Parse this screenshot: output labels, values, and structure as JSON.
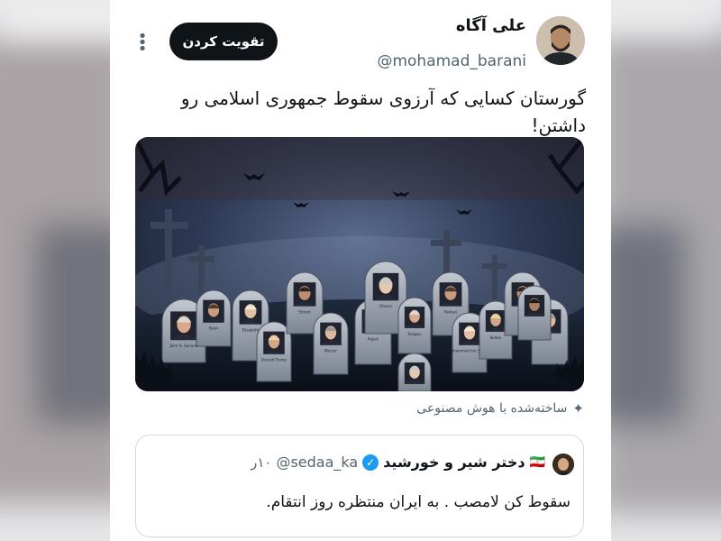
{
  "post": {
    "display_name": "علی آگاه",
    "handle": "@mohamad_barani",
    "follow_label": "تقویت کردن",
    "more_icon": "more-vertical-icon",
    "text": "گورستان کسایی که آرزوی سقوط جمهوری اسلامی رو داشتن!",
    "ai_label": "ساخته‌شده با هوش مصنوعی"
  },
  "media": {
    "description_icon": "graveyard-image",
    "tombstones": [
      {
        "caption": "John H. Sununu"
      },
      {
        "caption": "Bush"
      },
      {
        "caption": "Elizabeth"
      },
      {
        "caption": "Donald Trump"
      },
      {
        "caption": "Stroud"
      },
      {
        "caption": "Mercer"
      },
      {
        "caption": "Rajavi"
      },
      {
        "caption": "Sharon"
      },
      {
        "caption": "Reagan"
      },
      {
        "caption": "Pahlavi"
      },
      {
        "caption": "Mohammed bin Salman"
      },
      {
        "caption": "Bolton"
      },
      {
        "caption": "Gen"
      }
    ]
  },
  "quote": {
    "name": "دختر شیر و خورشید",
    "flag": "🇮🇷",
    "handle": "@sedaa_ka",
    "time": "۱۰ر",
    "text": "سقوط کن لامصب . به ایران منتظره روز انتقام."
  },
  "colors": {
    "accent": "#1d9bf0",
    "text": "#0f1419",
    "muted": "#536471",
    "button": "#0f1419"
  }
}
